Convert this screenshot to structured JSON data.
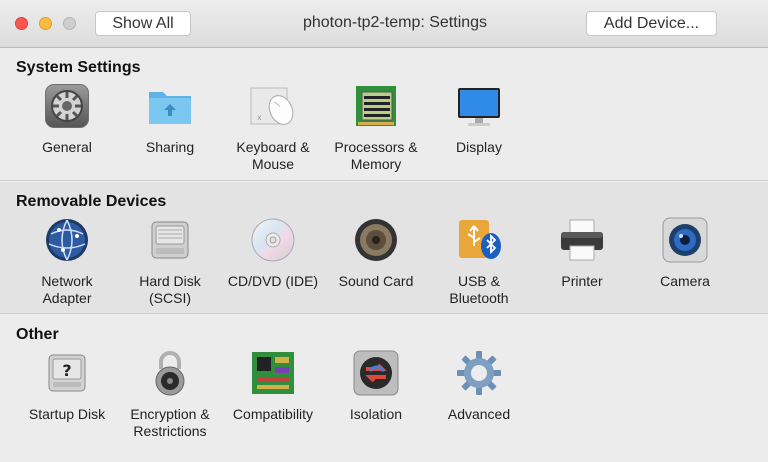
{
  "window": {
    "title": "photon-tp2-temp: Settings",
    "show_all_label": "Show All",
    "add_device_label": "Add Device..."
  },
  "sections": {
    "system": {
      "title": "System Settings",
      "items": {
        "general": {
          "label": "General",
          "icon": "gear-icon"
        },
        "sharing": {
          "label": "Sharing",
          "icon": "folder-share-icon"
        },
        "keyboard": {
          "label": "Keyboard &\nMouse",
          "icon": "keyboard-mouse-icon"
        },
        "processors": {
          "label": "Processors &\nMemory",
          "icon": "chip-icon"
        },
        "display": {
          "label": "Display",
          "icon": "monitor-icon"
        }
      }
    },
    "removable": {
      "title": "Removable Devices",
      "items": {
        "network": {
          "label": "Network\nAdapter",
          "icon": "globe-icon"
        },
        "harddisk": {
          "label": "Hard Disk\n(SCSI)",
          "icon": "hard-disk-icon"
        },
        "cddvd": {
          "label": "CD/DVD (IDE)",
          "icon": "disc-icon"
        },
        "sound": {
          "label": "Sound Card",
          "icon": "speaker-icon"
        },
        "usb": {
          "label": "USB &\nBluetooth",
          "icon": "usb-bluetooth-icon"
        },
        "printer": {
          "label": "Printer",
          "icon": "printer-icon"
        },
        "camera": {
          "label": "Camera",
          "icon": "camera-icon"
        }
      }
    },
    "other": {
      "title": "Other",
      "items": {
        "startup": {
          "label": "Startup Disk",
          "icon": "startup-disk-icon"
        },
        "encryption": {
          "label": "Encryption &\nRestrictions",
          "icon": "padlock-icon"
        },
        "compatibility": {
          "label": "Compatibility",
          "icon": "circuit-board-icon"
        },
        "isolation": {
          "label": "Isolation",
          "icon": "isolation-icon"
        },
        "advanced": {
          "label": "Advanced",
          "icon": "advanced-gear-icon"
        }
      }
    }
  }
}
